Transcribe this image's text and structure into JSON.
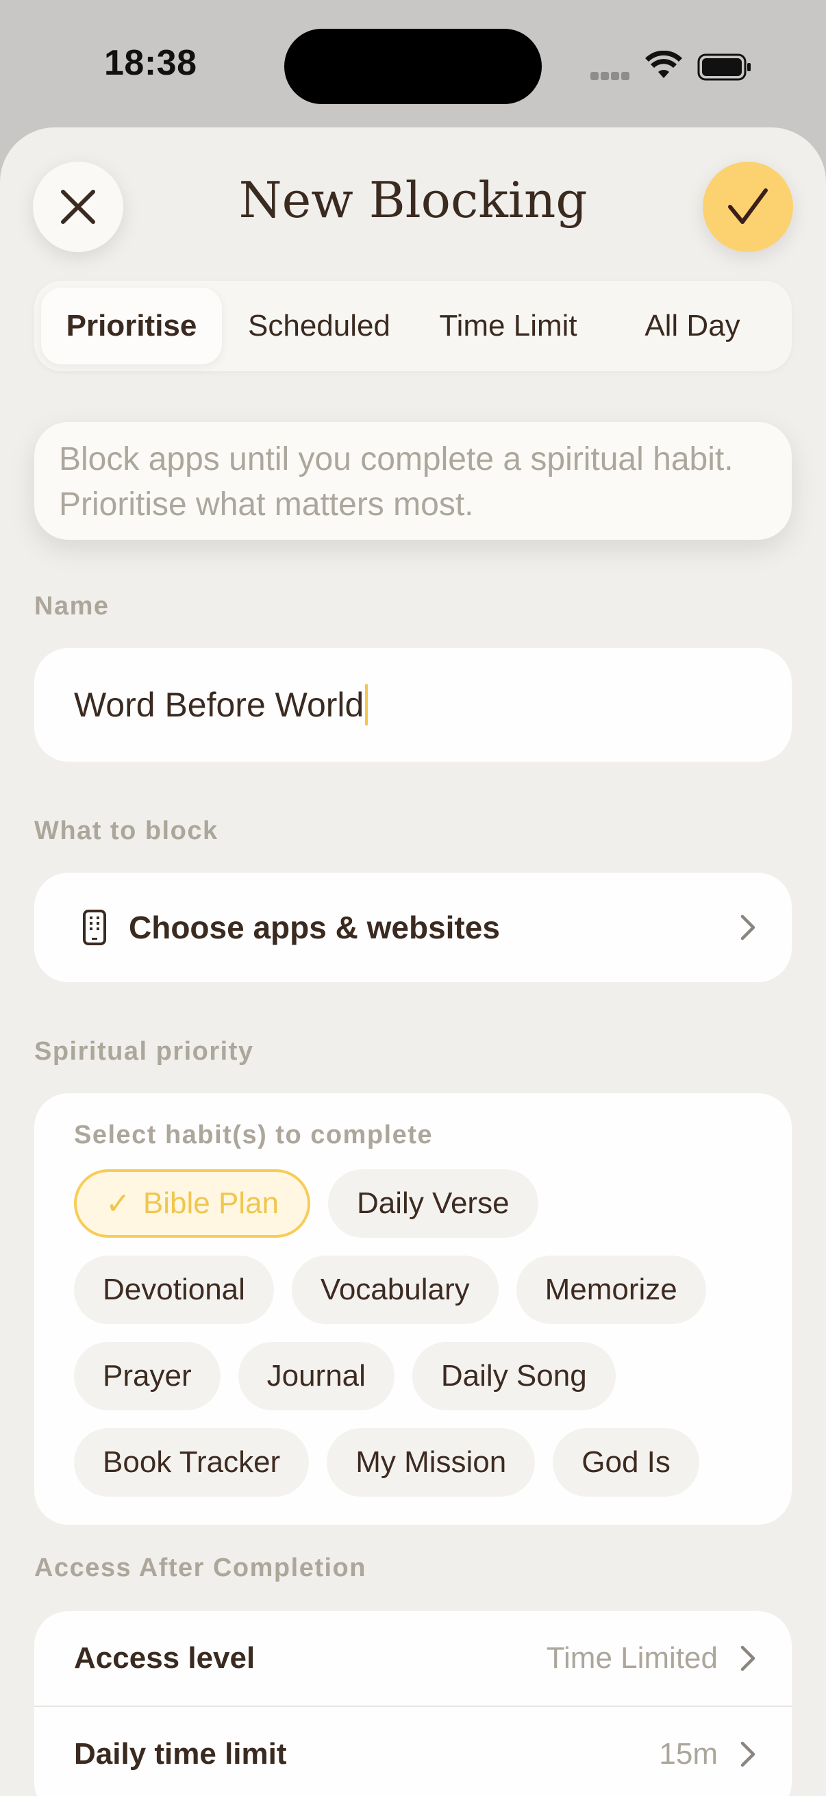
{
  "status": {
    "time": "18:38"
  },
  "header": {
    "title": "New Blocking",
    "close_icon": "close-icon",
    "confirm_icon": "checkmark-icon",
    "accent": "#fcd271"
  },
  "tabs": [
    {
      "label": "Prioritise",
      "active": true
    },
    {
      "label": "Scheduled",
      "active": false
    },
    {
      "label": "Time Limit",
      "active": false
    },
    {
      "label": "All Day",
      "active": false
    }
  ],
  "description": "Block apps until you complete a spiritual habit. Prioritise what matters most.",
  "name_section": {
    "label": "Name",
    "value": "Word Before World"
  },
  "block_section": {
    "label": "What to block",
    "choose_label": "Choose apps & websites",
    "icon": "phone-icon"
  },
  "priority_section": {
    "label": "Spiritual priority",
    "subtitle": "Select habit(s) to complete",
    "habits": [
      {
        "label": "Bible Plan",
        "selected": true
      },
      {
        "label": "Daily Verse",
        "selected": false
      },
      {
        "label": "Devotional",
        "selected": false
      },
      {
        "label": "Vocabulary",
        "selected": false
      },
      {
        "label": "Memorize",
        "selected": false
      },
      {
        "label": "Prayer",
        "selected": false
      },
      {
        "label": "Journal",
        "selected": false
      },
      {
        "label": "Daily Song",
        "selected": false
      },
      {
        "label": "Book Tracker",
        "selected": false
      },
      {
        "label": "My Mission",
        "selected": false
      },
      {
        "label": "God Is",
        "selected": false
      }
    ]
  },
  "access_section": {
    "label": "Access After Completion",
    "rows": [
      {
        "label": "Access level",
        "value": "Time Limited"
      },
      {
        "label": "Daily time limit",
        "value": "15m"
      }
    ]
  }
}
